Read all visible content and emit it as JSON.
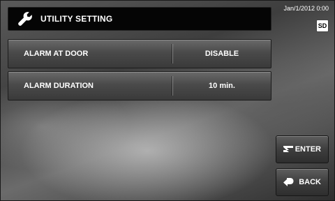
{
  "header": {
    "title": "UTILITY SETTING",
    "icon": "wrench-icon"
  },
  "status": {
    "datetime": "Jan/1/2012 0:00",
    "sd_badge": "SD"
  },
  "settings": [
    {
      "label": "ALARM AT DOOR",
      "value": "DISABLE"
    },
    {
      "label": "ALARM DURATION",
      "value": "10 min."
    }
  ],
  "buttons": {
    "enter": {
      "label": "ENTER",
      "icon": "enter-icon"
    },
    "back": {
      "label": "BACK",
      "icon": "back-icon"
    }
  },
  "colors": {
    "title_bar_bg": "#050505",
    "text": "#ffffff"
  }
}
